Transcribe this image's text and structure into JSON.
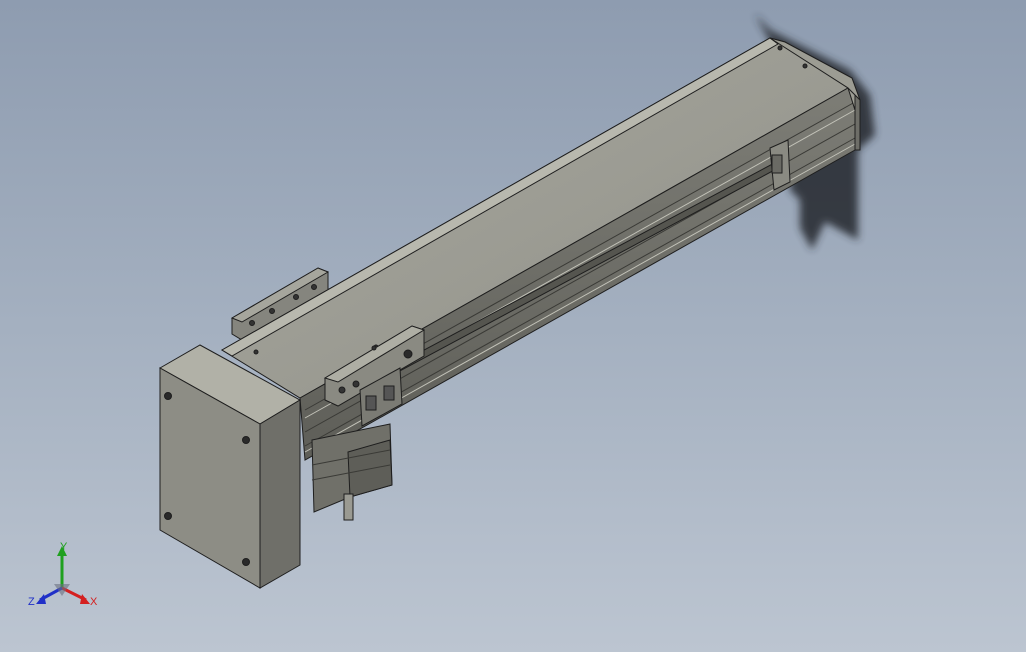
{
  "viewport": {
    "background_top": "#8e9cb0",
    "background_bottom": "#bcc5d1"
  },
  "model": {
    "icon": "linear-actuator-3d-model",
    "body_color": "#8f8f87",
    "edge_color": "#1e1e1e"
  },
  "triad": {
    "x_label": "X",
    "y_label": "Y",
    "z_label": "Z",
    "x_color": "#d42020",
    "y_color": "#1fa01f",
    "z_color": "#2030c8"
  }
}
